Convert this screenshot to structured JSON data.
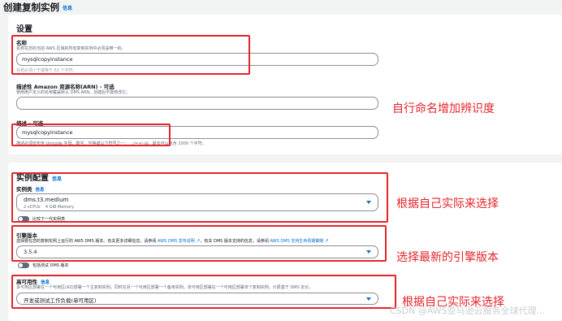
{
  "page": {
    "title": "创建复制实例",
    "info_label": "信息"
  },
  "settings": {
    "heading": "设置",
    "name": {
      "label": "名称",
      "desc": "名称在您的当前 AWS 区域的所有复制实例中必须是唯一的。",
      "value": "mysqlcopyinstance",
      "hint": "名称必须少于或等于 63 个字符。"
    },
    "arn": {
      "label": "描述性 Amazon 资源名称(ARN) - 可选",
      "desc": "使用用户定义的名称覆盖默认 DMS ARN。创建后不能修改它。",
      "value": ""
    },
    "description": {
      "label": "描述 - 可选",
      "value": "mysqlcopyinstance",
      "hint": "描述必须仅包含 Unicode 字母、数字、空格或以下符号之一：_.:/=+\\-@。最长可以包含 1000 个字符。"
    }
  },
  "instance_config": {
    "heading": "实例配置",
    "info_label": "信息",
    "class": {
      "label": "实例类",
      "info_label": "信息",
      "value": "dms.t3.medium",
      "sub": "2 vCPUs    4 GiB Memory",
      "compare_label": "比较下一代实例类"
    },
    "engine": {
      "label": "引擎版本",
      "desc_a": "选择要在您的复制实例上运行的 AWS DMS 版本。有关更多详细信息，请参阅",
      "link_a": "AWS DMS 发布说明",
      "desc_b": "。有关 DMS 版本支持的信息，请参阅",
      "link_b": "AWS DMS 支持生命周期策略",
      "value": "3.5.4",
      "beta_label": "包括测试 DMS 版本"
    },
    "availability": {
      "label": "高可用性",
      "info_label": "信息",
      "desc": "多可用区部署在一个可用区(AZ)部署一个主复制实例，同时在另一个可用区部署一个备用实例。单可用区部署在一个可用区部署单个复制实例。计费基于 DMS 定价。",
      "value": "开发或测试工作负载(单可用区)"
    }
  },
  "annotations": {
    "a1": "自行命名增加辨识度",
    "a2": "根据自己实际来选择",
    "a3": "选择最新的引擎版本",
    "a4": "根据自己实际来选择"
  },
  "watermark": "CSDN @AWS亚马逊云服务全球代理..."
}
